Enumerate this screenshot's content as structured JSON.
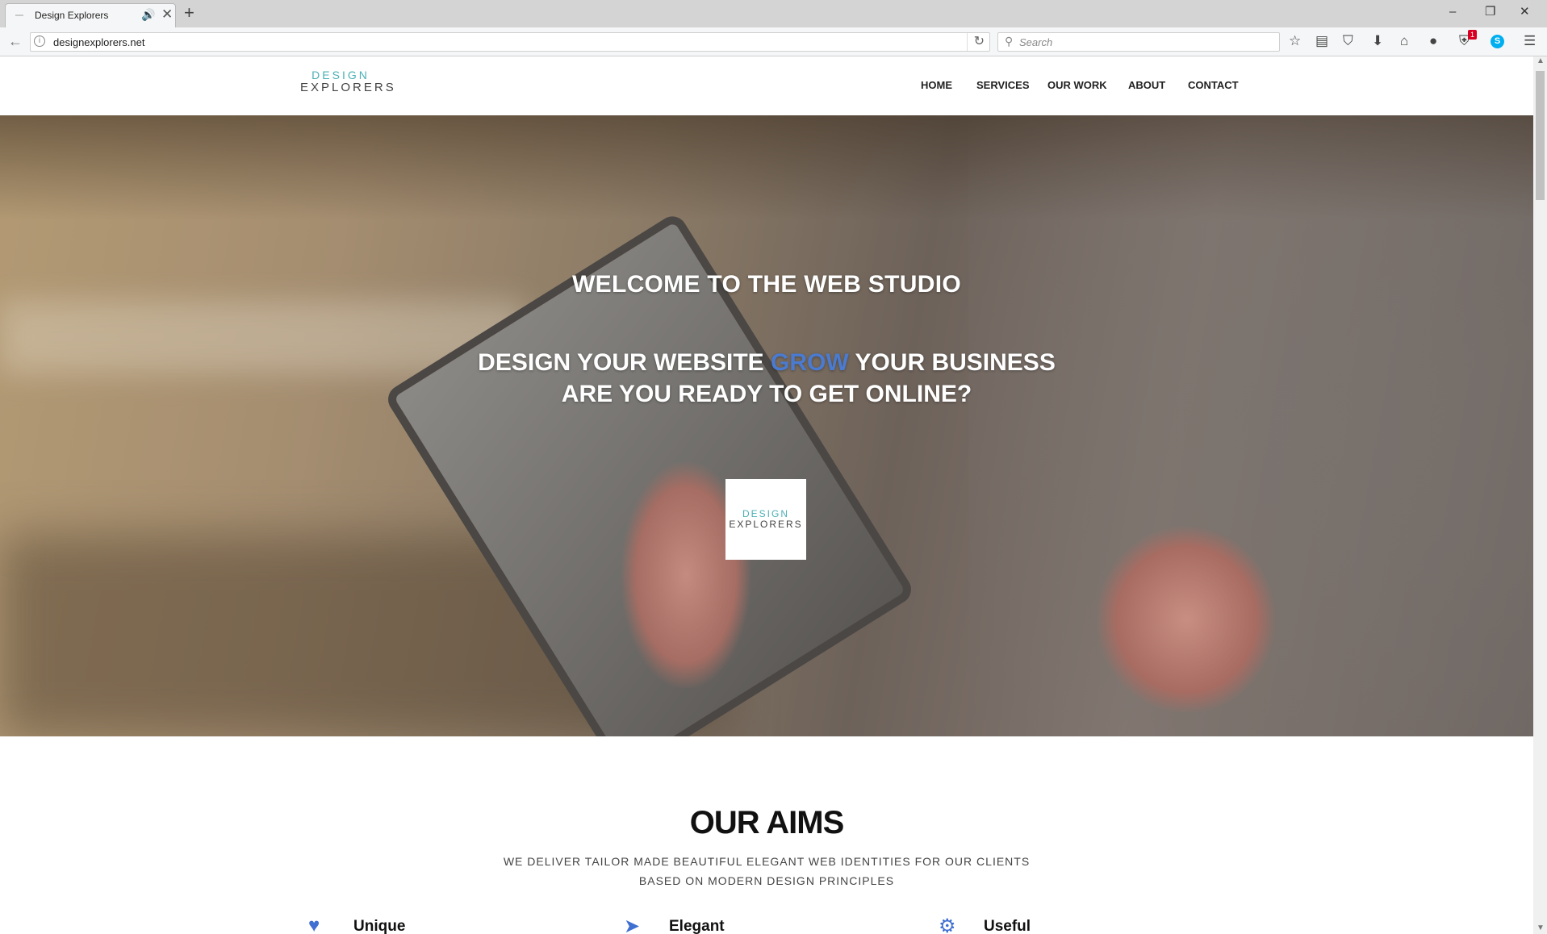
{
  "browser": {
    "tab_title": "Design Explorers",
    "tab_close": "✕",
    "new_tab": "+",
    "url": "designexplorers.net",
    "search_placeholder": "Search",
    "notification_badge": "1",
    "window": {
      "minimize": "‒",
      "restore": "❐",
      "close": "✕"
    },
    "toolbar_icons": [
      "star-icon",
      "reading-list-icon",
      "pocket-icon",
      "download-icon",
      "home-icon",
      "chat-icon",
      "shield-icon",
      "skype-icon",
      "menu-icon"
    ]
  },
  "site": {
    "logo_line1": "DESIGN",
    "logo_line2": "EXPLORERS",
    "nav": [
      "HOME",
      "SERVICES",
      "OUR WORK",
      "ABOUT",
      "CONTACT"
    ]
  },
  "hero": {
    "welcome": "WELCOME TO THE WEB STUDIO",
    "tagline_part1": "DESIGN YOUR WEBSITE ",
    "tagline_highlight": "GROW",
    "tagline_part2": " YOUR BUSINESS",
    "tagline_line2": "ARE YOU READY TO GET ONLINE?",
    "highlight_color": "#4a7bd0"
  },
  "aims": {
    "title": "OUR AIMS",
    "subtitle_line1": "WE DELIVER TAILOR MADE BEAUTIFUL ELEGANT WEB IDENTITIES FOR OUR CLIENTS",
    "subtitle_line2": "BASED ON MODERN DESIGN PRINCIPLES",
    "features": [
      {
        "label": "Unique",
        "icon": "heart-icon"
      },
      {
        "label": "Elegant",
        "icon": "paper-plane-icon"
      },
      {
        "label": "Useful",
        "icon": "gears-icon"
      }
    ]
  },
  "colors": {
    "accent": "#4a7bd0",
    "logo_teal": "#4bb0b5"
  }
}
